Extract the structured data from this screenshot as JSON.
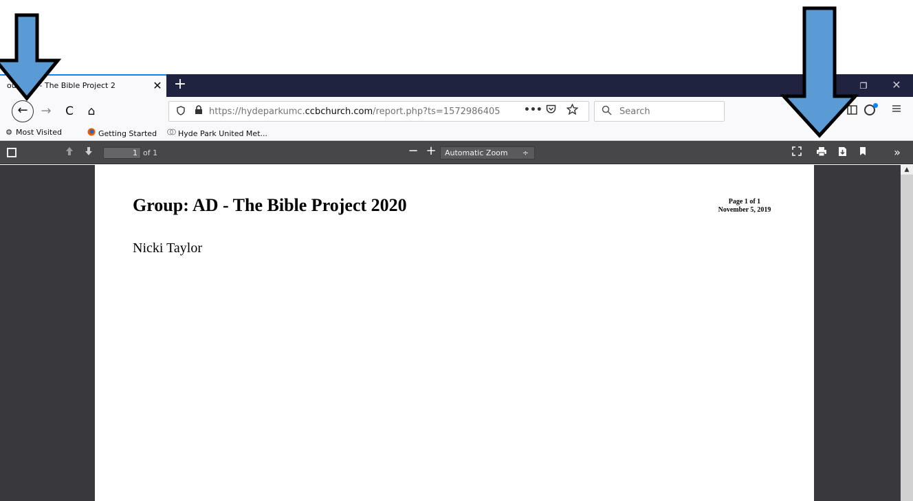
{
  "browser": {
    "tab": {
      "title": "oup: AD - The Bible Project 2",
      "close": "✕"
    },
    "new_tab": "+",
    "window_controls": {
      "restore": "❐",
      "close": "✕"
    },
    "nav": {
      "back": "←",
      "forward": "→",
      "reload": "C",
      "home": "⌂"
    },
    "url": {
      "prefix": "https://hydeparkumc.",
      "domain": "ccbchurch.com",
      "suffix": "/report.php?ts=1572986405",
      "more": "•••"
    },
    "search": {
      "placeholder": "Search"
    },
    "bookmarks": [
      {
        "label": "Most Visited",
        "icon": "gear-icon"
      },
      {
        "label": "Getting Started",
        "icon": "firefox-icon"
      },
      {
        "label": "Hyde Park United Met...",
        "icon": "church-icon"
      }
    ]
  },
  "pdf_toolbar": {
    "page_current": "1",
    "page_of": "of 1",
    "zoom": "Automatic Zoom",
    "zoom_caret": "÷"
  },
  "document": {
    "title": "Group: AD - The Bible Project 2020",
    "page_label": "Page 1 of 1",
    "date": "November 5, 2019",
    "member": "Nicki Taylor"
  },
  "annotations": {
    "arrow_color": "#5b9bd5"
  }
}
